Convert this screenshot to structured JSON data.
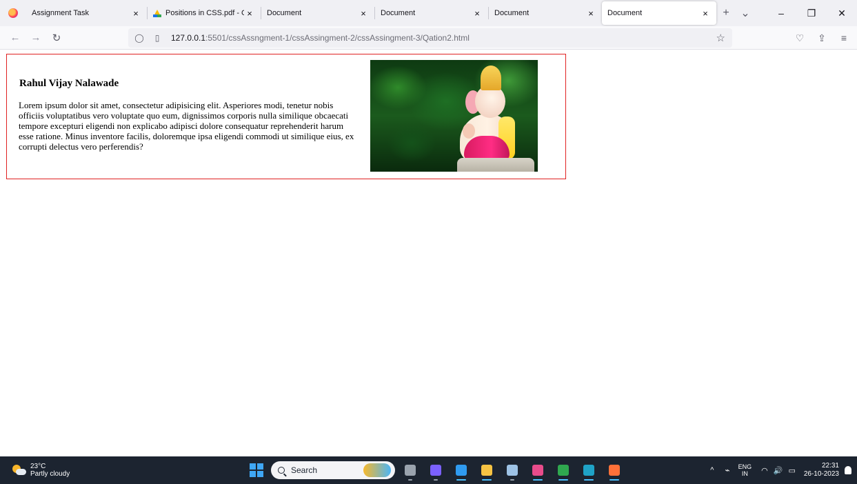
{
  "browser": {
    "tabs": [
      {
        "title": "Assignment Task",
        "active": false,
        "icon": "none"
      },
      {
        "title": "Positions in CSS.pdf - Googl",
        "active": false,
        "icon": "google-drive-icon"
      },
      {
        "title": "Document",
        "active": false,
        "icon": "none"
      },
      {
        "title": "Document",
        "active": false,
        "icon": "none"
      },
      {
        "title": "Document",
        "active": false,
        "icon": "none"
      },
      {
        "title": "Document",
        "active": true,
        "icon": "none"
      }
    ],
    "close_glyph": "×",
    "new_tab_glyph": "+",
    "list_tabs_glyph": "⌄",
    "window_controls": {
      "minimize": "–",
      "restore": "❐",
      "close": "✕"
    },
    "nav": {
      "back": "←",
      "forward": "→",
      "reload": "↻"
    },
    "url": {
      "host": "127.0.0.1",
      "rest": ":5501/cssAssngment-1/cssAssingment-2/cssAssingment-3/Qation2.html"
    },
    "star_glyph": "☆",
    "right_icons": {
      "pocket": "♡",
      "share": "⇪",
      "menu": "≡"
    }
  },
  "page": {
    "name": "Rahul Vijay Nalawade",
    "paragraph": "Lorem ipsum dolor sit amet, consectetur adipisicing elit. Asperiores modi, tenetur nobis officiis voluptatibus vero voluptate quo eum, dignissimos corporis nulla similique obcaecati tempore excepturi eligendi non explicabo adipisci dolore consequatur reprehenderit harum esse ratione. Minus inventore facilis, doloremque ipsa eligendi commodi ut similique eius, ex corrupti delectus vero perferendis?",
    "card_border_color": "#e02020"
  },
  "taskbar": {
    "weather": {
      "temp": "23°C",
      "desc": "Partly cloudy"
    },
    "search_label": "Search",
    "apps": [
      {
        "name": "file-manager-icon",
        "color": "#9aa3ae",
        "active": false
      },
      {
        "name": "chat-icon",
        "color": "#7b61ff",
        "active": false
      },
      {
        "name": "vscode-icon",
        "color": "#2f9bf0",
        "active": true
      },
      {
        "name": "folder-icon",
        "color": "#f6c343",
        "active": true
      },
      {
        "name": "settings-icon",
        "color": "#9ec3e6",
        "active": false
      },
      {
        "name": "intellij-icon",
        "color": "#e84c8b",
        "active": true
      },
      {
        "name": "chrome-icon",
        "color": "#2fa84f",
        "active": true
      },
      {
        "name": "edge-icon",
        "color": "#1fa3c7",
        "active": true
      },
      {
        "name": "firefox-icon",
        "color": "#ff7139",
        "active": true
      }
    ],
    "tray": {
      "chevron": "^",
      "lang_top": "ENG",
      "lang_bottom": "IN",
      "wifi": "◠",
      "volume": "🔊",
      "battery": "▭",
      "time": "22:31",
      "date": "26-10-2023"
    }
  }
}
